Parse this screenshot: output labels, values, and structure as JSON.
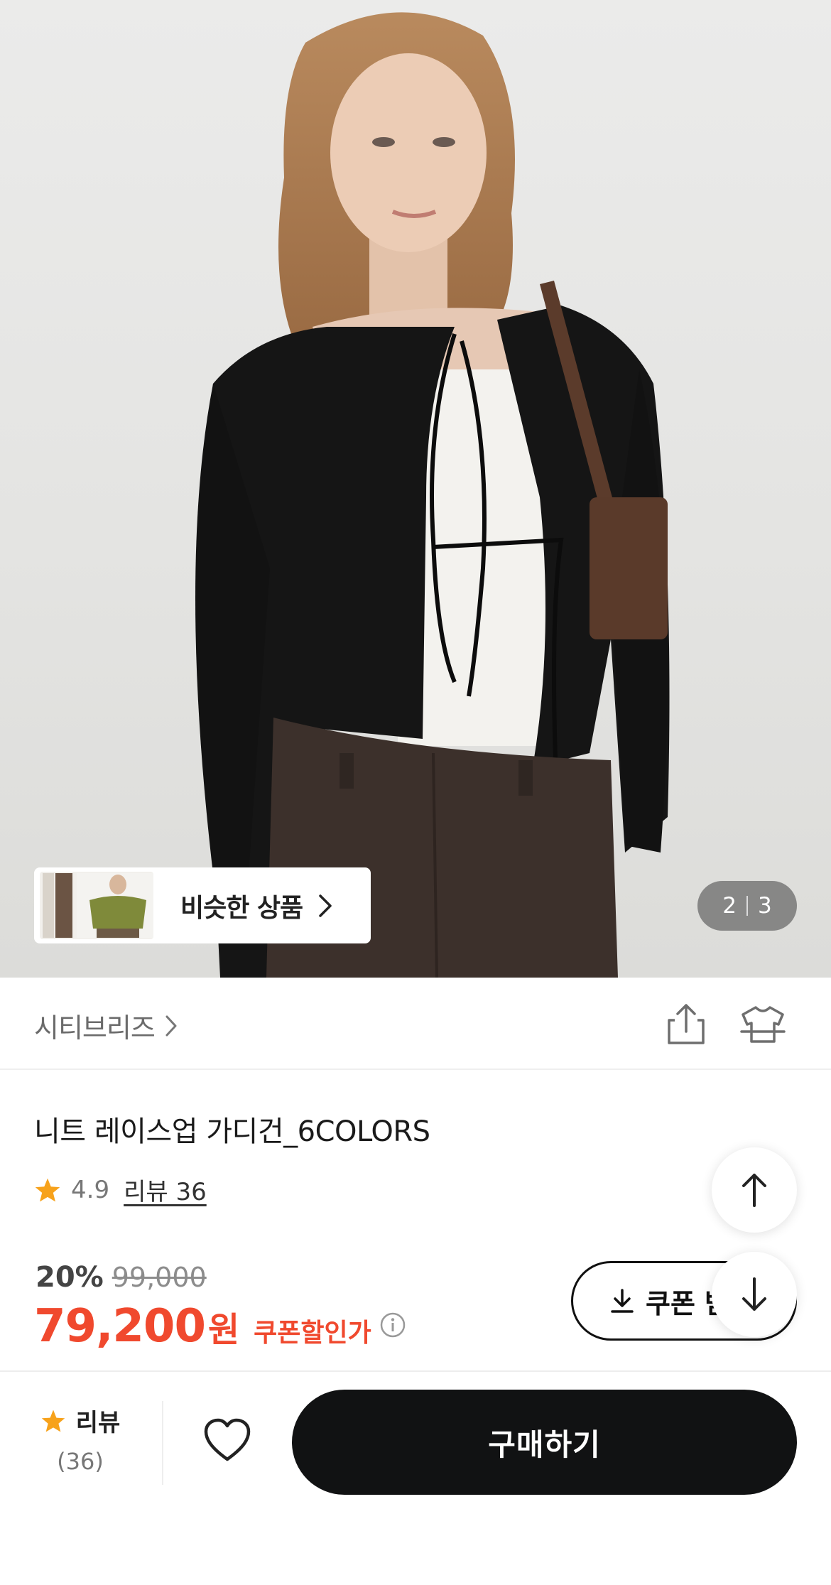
{
  "gallery": {
    "current": "2",
    "total": "3",
    "similar_label": "비슷한 상품"
  },
  "brand": {
    "name": "시티브리즈"
  },
  "product": {
    "title": "니트 레이스업 가디건_6COLORS",
    "rating": "4.9",
    "reviews_label": "리뷰 36",
    "discount_rate": "20%",
    "original_price": "99,000",
    "price": "79,200",
    "currency": "원",
    "coupon_price_label": "쿠폰할인가",
    "coupon_button_label": "쿠폰 받"
  },
  "bottom_bar": {
    "review_label": "리뷰",
    "review_count": "(36)",
    "buy_label": "구매하기"
  },
  "colors": {
    "accent_red": "#f0492e",
    "star": "#f7a21b",
    "buy_button": "#111213"
  },
  "icons": {
    "share": "share-icon",
    "hanger": "clothes-hanger-icon",
    "star": "star-icon",
    "heart": "heart-icon",
    "arrow_up": "arrow-up-icon",
    "arrow_down": "arrow-down-icon",
    "download": "download-icon",
    "info": "info-icon",
    "chevron_right": "chevron-right-icon"
  }
}
